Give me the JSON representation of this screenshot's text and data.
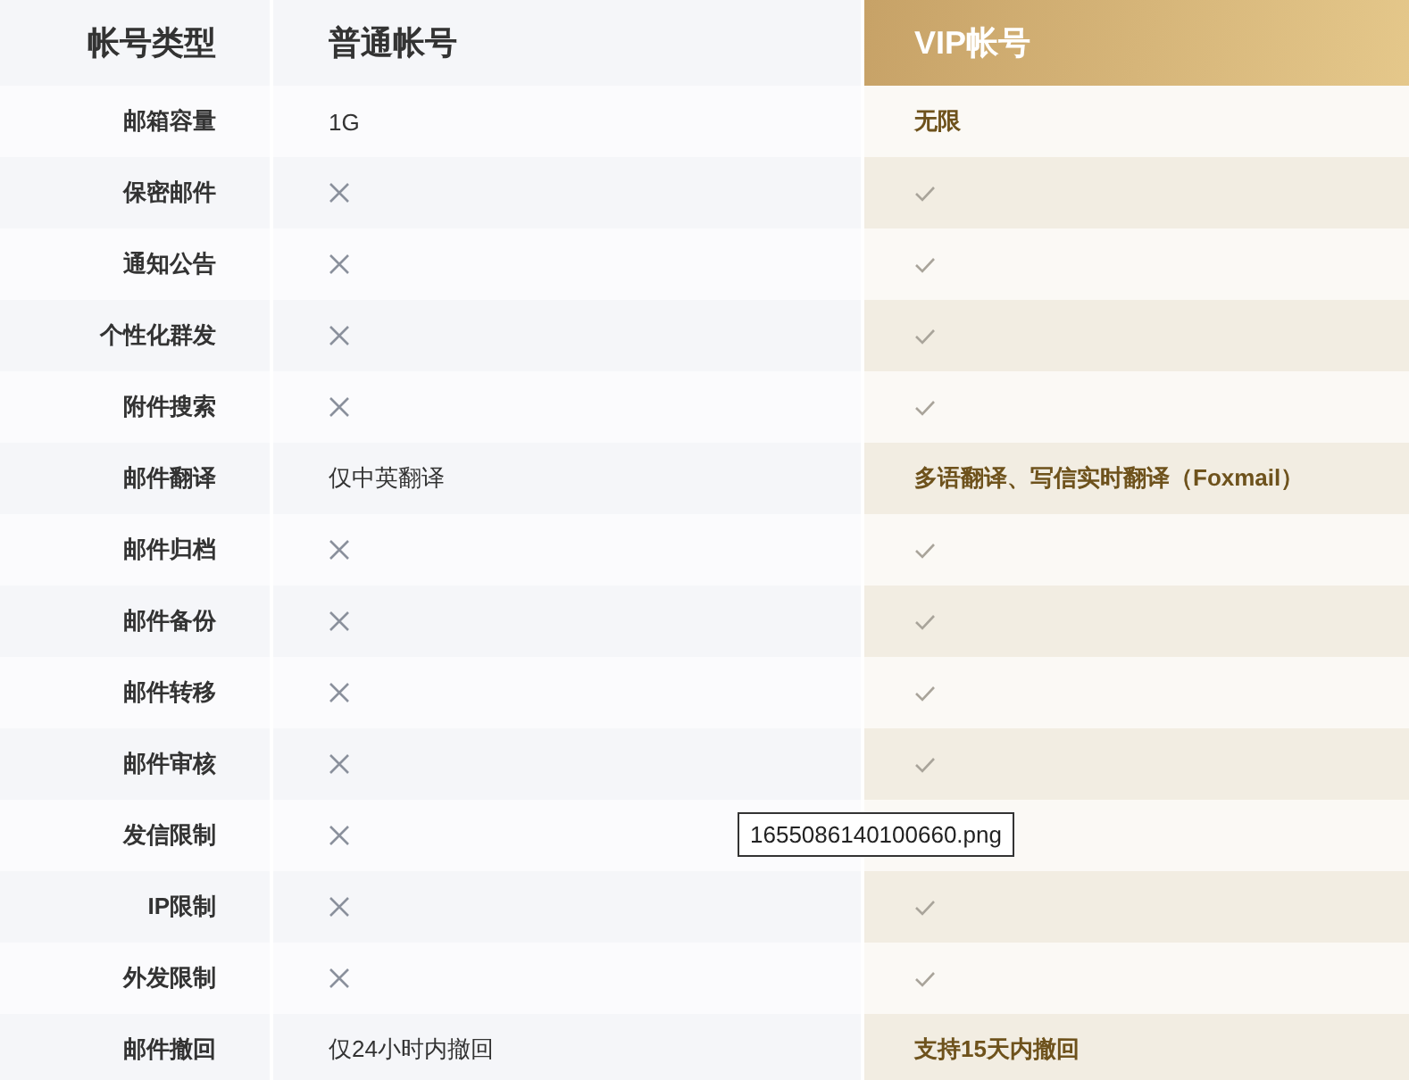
{
  "columns": [
    "帐号类型",
    "普通帐号",
    "VIP帐号"
  ],
  "rows": [
    {
      "label": "邮箱容量",
      "basic": {
        "kind": "text",
        "text": "1G"
      },
      "vip": {
        "kind": "text",
        "text": "无限"
      }
    },
    {
      "label": "保密邮件",
      "basic": {
        "kind": "cross"
      },
      "vip": {
        "kind": "check"
      }
    },
    {
      "label": "通知公告",
      "basic": {
        "kind": "cross"
      },
      "vip": {
        "kind": "check"
      }
    },
    {
      "label": "个性化群发",
      "basic": {
        "kind": "cross"
      },
      "vip": {
        "kind": "check"
      }
    },
    {
      "label": "附件搜索",
      "basic": {
        "kind": "cross"
      },
      "vip": {
        "kind": "check"
      }
    },
    {
      "label": "邮件翻译",
      "basic": {
        "kind": "text",
        "text": "仅中英翻译"
      },
      "vip": {
        "kind": "text",
        "text": "多语翻译、写信实时翻译（Foxmail）"
      }
    },
    {
      "label": "邮件归档",
      "basic": {
        "kind": "cross"
      },
      "vip": {
        "kind": "check"
      }
    },
    {
      "label": "邮件备份",
      "basic": {
        "kind": "cross"
      },
      "vip": {
        "kind": "check"
      }
    },
    {
      "label": "邮件转移",
      "basic": {
        "kind": "cross"
      },
      "vip": {
        "kind": "check"
      }
    },
    {
      "label": "邮件审核",
      "basic": {
        "kind": "cross"
      },
      "vip": {
        "kind": "check"
      }
    },
    {
      "label": "发信限制",
      "basic": {
        "kind": "cross"
      },
      "vip": {
        "kind": "covered"
      }
    },
    {
      "label": "IP限制",
      "basic": {
        "kind": "cross"
      },
      "vip": {
        "kind": "check"
      }
    },
    {
      "label": "外发限制",
      "basic": {
        "kind": "cross"
      },
      "vip": {
        "kind": "check"
      }
    },
    {
      "label": "邮件撤回",
      "basic": {
        "kind": "text",
        "text": "仅24小时内撤回"
      },
      "vip": {
        "kind": "text",
        "text": "支持15天内撤回"
      }
    }
  ],
  "tooltip": {
    "text": "1655086140100660.png"
  }
}
